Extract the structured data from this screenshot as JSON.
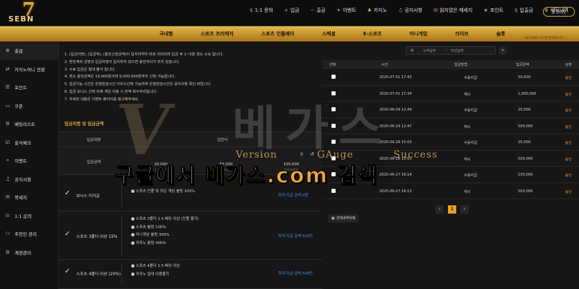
{
  "logo": {
    "numeral": "7",
    "text": "SEBN"
  },
  "topnav": [
    {
      "icon": "$",
      "label": "1:1 문의"
    },
    {
      "icon": "+",
      "label": "입금"
    },
    {
      "icon": "−",
      "label": "출금"
    },
    {
      "icon": "✦",
      "label": "이벤트"
    },
    {
      "icon": "♣",
      "label": "카지노"
    },
    {
      "icon": "♫",
      "label": "공지사항"
    },
    {
      "icon": "✉",
      "label": "읽지않은 메세지"
    },
    {
      "icon": "★",
      "label": "포인트"
    },
    {
      "icon": "$",
      "label": "입출금"
    },
    {
      "icon": "♛",
      "label": "베팅내역"
    }
  ],
  "login_label": "로그아웃",
  "cash_note": "SEVEN에 오신걸 환영합니다",
  "goldnav": [
    "국내형",
    "스포츠 프리매치",
    "스포츠 인플레이",
    "스페셜",
    "E-스포츠",
    "미니게임",
    "라이브",
    "슬롯"
  ],
  "sidebar": [
    {
      "icon": "⊕",
      "label": "출금"
    },
    {
      "icon": "⇄",
      "label": "카지노머니 전환"
    },
    {
      "icon": "☰",
      "label": "포인트"
    },
    {
      "icon": "▭",
      "label": "쿠폰"
    },
    {
      "icon": "⚙",
      "label": "베팅리스트"
    },
    {
      "icon": "☑",
      "label": "출석체크"
    },
    {
      "icon": "✧",
      "label": "이벤트"
    },
    {
      "icon": "♫",
      "label": "공지사항"
    },
    {
      "icon": "✉",
      "label": "쪽세지"
    },
    {
      "icon": "☏",
      "label": "1:1 문의"
    },
    {
      "icon": "⚇",
      "label": "추천인 관리"
    },
    {
      "icon": "⚙",
      "label": "계정관리"
    }
  ],
  "rules": [
    "1. (입금자명), (입금액), (충전신청금액)이 일치하여야 바로 처리되며 입금 후 1~5분 정도 소요 됩니다.",
    "2. 환전계좌 성명과 입금자명이 일치하지 않으면 충전처리가 되지 않습니다.",
    "3. 수표 입금은 절대 불가 합니다.",
    "4. 최소 충전금액은 10,000원이며 9,000,000원까지 신청 가능합니다.",
    "5. 입금가능 시간은 은행점검시간 이외시간에 가능하며 은행점검시간은 공지사항 확인 바랍니다.",
    "6. 입금 보너스 선택 외에 게임 이용 시 전액 회수처리됩니다.",
    "7. 자세한 내용은 이벤트 페이지를 참고해주세요."
  ],
  "deposit_section": {
    "title": "입금자명 및 입금금액",
    "name_label": "입금자명",
    "name_value": "김현식",
    "amount_label": "입금금액",
    "amount_value": "0",
    "chips": [
      {
        "amount": "10,000",
        "sub": "10,000원"
      },
      {
        "amount": "50,000",
        "sub": "50,000원"
      },
      {
        "amount": "100,000",
        "sub": "100,000원"
      }
    ]
  },
  "bonuses": [
    {
      "name": "보너스 미지급",
      "details": [
        "■ 스포츠 단폴 및 모든 게임 롤링 100%"
      ],
      "max": "최대 지급 금액 0원"
    },
    {
      "name": "스포츠 3폴더 이상 15%",
      "details": [
        "■ 스포츠 3폴더 1.5 배당 이상 (단폴 불가)",
        "■ 스포츠 롤링 100%",
        "■ 미니게임 롤링 300%",
        "■ 카지노 롤링 400%"
      ],
      "max": "최대 지급 금액 500만"
    },
    {
      "name": "스포츠 4폴더 이상 (20%)",
      "details": [
        "■ 스포츠 4폴더 1.5 배당 이상",
        "■ 카지노 절대 이용불가"
      ],
      "max": "최대 지급 금액 500만"
    }
  ],
  "history": {
    "date_start_placeholder": "시작날짜",
    "date_end_placeholder": "마감날짜",
    "columns": [
      "선택",
      "시간",
      "입금방법",
      "입금금액",
      "상태"
    ],
    "rows": [
      {
        "time": "2025-07-01 17:42",
        "method": "수동지급",
        "amount": "50,000",
        "status": "승인"
      },
      {
        "time": "2025-07-01 17:34",
        "method": "캐시",
        "amount": "1,000,000",
        "status": "승인"
      },
      {
        "time": "2025-06-29 12:49",
        "method": "수동지급",
        "amount": "25,000",
        "status": "승인"
      },
      {
        "time": "2025-06-29 12:47",
        "method": "캐시",
        "amount": "500,000",
        "status": "승인"
      },
      {
        "time": "2025-06-28 15:05",
        "method": "수동지급",
        "amount": "25,000",
        "status": "승인"
      },
      {
        "time": "2025-06-28 15:03",
        "method": "캐시",
        "amount": "500,000",
        "status": "승인"
      },
      {
        "time": "2025-06-27 16:14",
        "method": "수동지급",
        "amount": "150,000",
        "status": "승인"
      },
      {
        "time": "2025-06-27 16:13",
        "method": "캐시",
        "amount": "500,000",
        "status": "승인"
      }
    ],
    "pager": {
      "prev": "‹",
      "current": "1",
      "next": "›"
    },
    "delete_label": "선택내역삭제"
  },
  "watermark": {
    "big": "베가스",
    "line": [
      "Version",
      "GAuge",
      "Success"
    ]
  },
  "banner": {
    "w1": "구글에서",
    "w2": "베가스",
    "w3": ".com",
    "w4": "검색"
  },
  "colors": {
    "accent": "#d9a93a",
    "gold_bar": "#c6952e",
    "status": "#e4a93a",
    "link": "#4a8ee0"
  }
}
